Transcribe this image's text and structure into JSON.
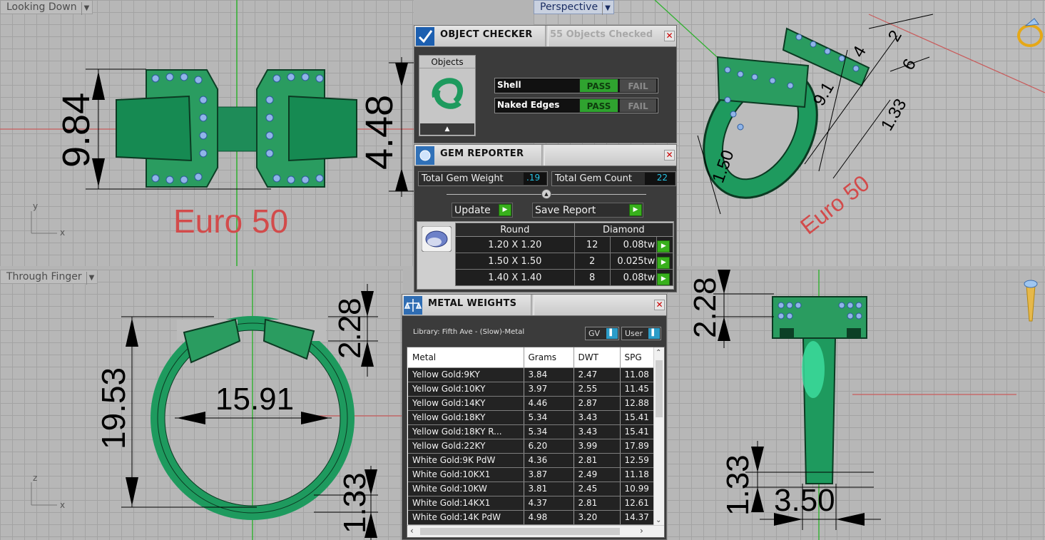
{
  "viewports": {
    "top_left": {
      "title": "Looking Down",
      "dims": [
        "9.84",
        "4.48"
      ],
      "label": "Euro 50",
      "axis": [
        "y",
        "x"
      ]
    },
    "top_right": {
      "title": "Perspective",
      "label": "Euro 50",
      "dims": [
        "2",
        "4",
        "9.1",
        "1.50",
        "1.33",
        "6"
      ]
    },
    "bottom_left": {
      "title": "Through Finger",
      "dims": [
        "19.53",
        "15.91",
        "2.28",
        "1.33"
      ],
      "axis": [
        "z",
        "x"
      ]
    },
    "bottom_right": {
      "dims": [
        "2.28",
        "1.33",
        "3.50"
      ]
    }
  },
  "object_checker": {
    "title": "OBJECT CHECKER",
    "objects_checked": "55  Objects Checked",
    "objects_label": "Objects",
    "checks": [
      {
        "name": "Shell",
        "pass": "PASS",
        "fail": "FAIL"
      },
      {
        "name": "Naked Edges",
        "pass": "PASS",
        "fail": "FAIL"
      }
    ],
    "close": "✕"
  },
  "gem_reporter": {
    "title": "GEM REPORTER",
    "total_weight_label": "Total Gem Weight",
    "total_weight": ".19",
    "total_count_label": "Total Gem Count",
    "total_count": "22",
    "update": "Update",
    "save": "Save Report",
    "shape": "Round",
    "gem": "Diamond",
    "rows": [
      {
        "size": "1.20 X 1.20",
        "count": "12",
        "tw": "0.08tw"
      },
      {
        "size": "1.50 X 1.50",
        "count": "2",
        "tw": "0.025tw"
      },
      {
        "size": "1.40 X 1.40",
        "count": "8",
        "tw": "0.08tw"
      }
    ],
    "close": "✕"
  },
  "metal_weights": {
    "title": "METAL WEIGHTS",
    "library": "Library: Fifth Ave - (Slow)-Metal",
    "gv": "GV",
    "user": "User",
    "headers": [
      "Metal",
      "Grams",
      "DWT",
      "SPG"
    ],
    "rows": [
      [
        "Yellow Gold:9KY",
        "3.84",
        "2.47",
        "11.08"
      ],
      [
        "Yellow Gold:10KY",
        "3.97",
        "2.55",
        "11.45"
      ],
      [
        "Yellow Gold:14KY",
        "4.46",
        "2.87",
        "12.88"
      ],
      [
        "Yellow Gold:18KY",
        "5.34",
        "3.43",
        "15.41"
      ],
      [
        "Yellow Gold:18KY R...",
        "5.34",
        "3.43",
        "15.41"
      ],
      [
        "Yellow Gold:22KY",
        "6.20",
        "3.99",
        "17.89"
      ],
      [
        "White Gold:9K PdW",
        "4.36",
        "2.81",
        "12.59"
      ],
      [
        "White Gold:10KX1",
        "3.87",
        "2.49",
        "11.18"
      ],
      [
        "White Gold:10KW",
        "3.81",
        "2.45",
        "10.99"
      ],
      [
        "White Gold:14KX1",
        "4.37",
        "2.81",
        "12.61"
      ],
      [
        "White Gold:14K PdW",
        "4.98",
        "3.20",
        "14.37"
      ]
    ],
    "close": "✕"
  },
  "colors": {
    "ring_green": "#1e9a5e",
    "gem_blue": "#8fb4e8",
    "pass_green": "#2fa32f",
    "euro_red": "#d24b4b"
  }
}
